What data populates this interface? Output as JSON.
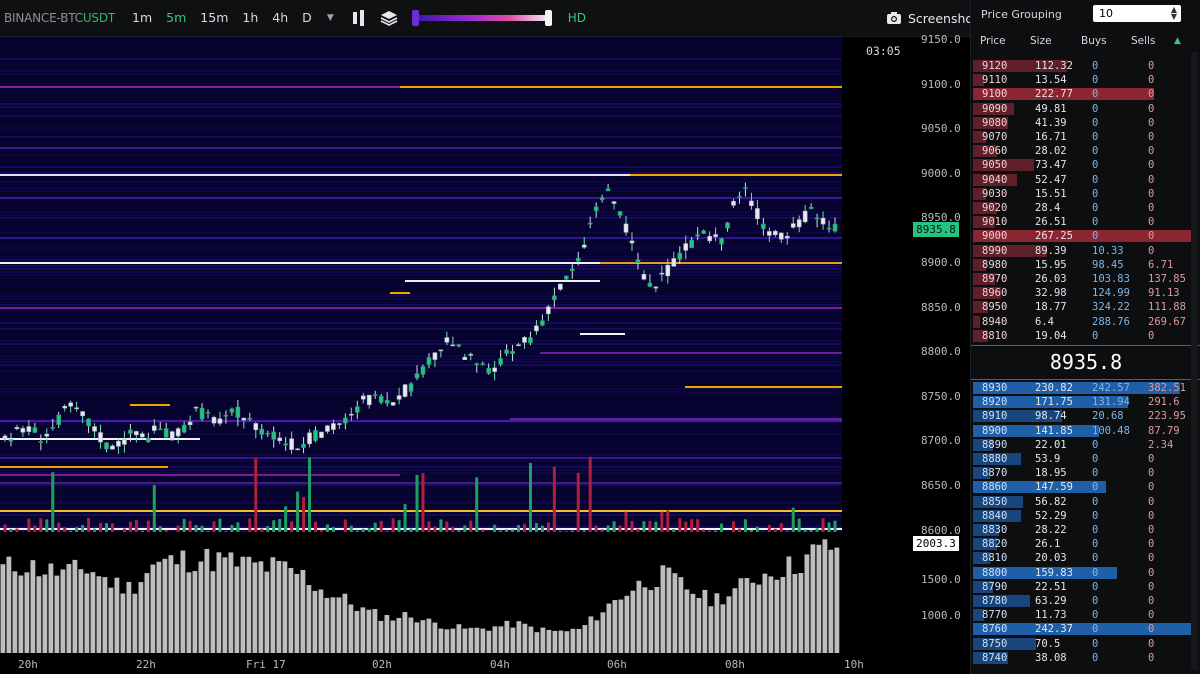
{
  "toolbar": {
    "exchange": "BINANCE-",
    "base": "BTC",
    "quote": "USDT",
    "timeframes": [
      "1m",
      "5m",
      "15m",
      "1h",
      "4h",
      "D"
    ],
    "active_timeframe": "5m",
    "hd_label": "HD",
    "screenshot_label": "Screenshot",
    "icons": [
      "bar-style-icon",
      "layers-icon",
      "camera-icon"
    ]
  },
  "chart": {
    "time_label": "03:05",
    "current_price": "8935.8",
    "volume_value": "2003.3",
    "price_ticks": [
      "9150.0",
      "9100.0",
      "9050.0",
      "9000.0",
      "8950.0",
      "8900.0",
      "8850.0",
      "8800.0",
      "8750.0",
      "8700.0",
      "8650.0",
      "8600.0"
    ],
    "volume_ticks": [
      "1500.0",
      "1000.0"
    ],
    "time_ticks": [
      "20h",
      "22h",
      "Fri 17",
      "02h",
      "04h",
      "06h",
      "08h",
      "10h"
    ],
    "colors": {
      "up": "#26c281",
      "down": "#e84a5f",
      "background": "#050326"
    }
  },
  "orderbook": {
    "grouping_label": "Price Grouping",
    "grouping_value": "10",
    "headers": {
      "price": "Price",
      "size": "Size",
      "buys": "Buys",
      "sells": "Sells"
    },
    "mid_price": "8935.8",
    "asks": [
      {
        "price": "9120",
        "size": "112.32",
        "buys": "0",
        "sells": "0",
        "depth": 0.43
      },
      {
        "price": "9110",
        "size": "13.54",
        "buys": "0",
        "sells": "0",
        "depth": 0.05
      },
      {
        "price": "9100",
        "size": "222.77",
        "buys": "0",
        "sells": "0",
        "depth": 0.83
      },
      {
        "price": "9090",
        "size": "49.81",
        "buys": "0",
        "sells": "0",
        "depth": 0.19
      },
      {
        "price": "9080",
        "size": "41.39",
        "buys": "0",
        "sells": "0",
        "depth": 0.16
      },
      {
        "price": "9070",
        "size": "16.71",
        "buys": "0",
        "sells": "0",
        "depth": 0.06
      },
      {
        "price": "9060",
        "size": "28.02",
        "buys": "0",
        "sells": "0",
        "depth": 0.11
      },
      {
        "price": "9050",
        "size": "73.47",
        "buys": "0",
        "sells": "0",
        "depth": 0.28
      },
      {
        "price": "9040",
        "size": "52.47",
        "buys": "0",
        "sells": "0",
        "depth": 0.2
      },
      {
        "price": "9030",
        "size": "15.51",
        "buys": "0",
        "sells": "0",
        "depth": 0.06
      },
      {
        "price": "9020",
        "size": "28.4",
        "buys": "0",
        "sells": "0",
        "depth": 0.11
      },
      {
        "price": "9010",
        "size": "26.51",
        "buys": "0",
        "sells": "0",
        "depth": 0.1
      },
      {
        "price": "9000",
        "size": "267.25",
        "buys": "0",
        "sells": "0",
        "depth": 1.0
      },
      {
        "price": "8990",
        "size": "89.39",
        "buys": "10.33",
        "sells": "0",
        "depth": 0.34
      },
      {
        "price": "8980",
        "size": "15.95",
        "buys": "98.45",
        "sells": "6.71",
        "depth": 0.06
      },
      {
        "price": "8970",
        "size": "26.03",
        "buys": "103.83",
        "sells": "137.85",
        "depth": 0.1
      },
      {
        "price": "8960",
        "size": "32.98",
        "buys": "124.99",
        "sells": "91.13",
        "depth": 0.13
      },
      {
        "price": "8950",
        "size": "18.77",
        "buys": "324.22",
        "sells": "111.88",
        "depth": 0.07
      },
      {
        "price": "8940",
        "size": "6.4",
        "buys": "288.76",
        "sells": "269.67",
        "depth": 0.03
      },
      {
        "price": "8810",
        "size": "19.04",
        "buys": "0",
        "sells": "0",
        "depth": 0.07
      }
    ],
    "bids": [
      {
        "price": "8930",
        "size": "230.82",
        "buys": "242.57",
        "sells": "382.51",
        "depth": 0.95
      },
      {
        "price": "8920",
        "size": "171.75",
        "buys": "131.94",
        "sells": "291.6",
        "depth": 0.71
      },
      {
        "price": "8910",
        "size": "98.74",
        "buys": "20.68",
        "sells": "223.95",
        "depth": 0.41
      },
      {
        "price": "8900",
        "size": "141.85",
        "buys": "100.48",
        "sells": "87.79",
        "depth": 0.58
      },
      {
        "price": "8890",
        "size": "22.01",
        "buys": "0",
        "sells": "2.34",
        "depth": 0.09
      },
      {
        "price": "8880",
        "size": "53.9",
        "buys": "0",
        "sells": "0",
        "depth": 0.22
      },
      {
        "price": "8870",
        "size": "18.95",
        "buys": "0",
        "sells": "0",
        "depth": 0.08
      },
      {
        "price": "8860",
        "size": "147.59",
        "buys": "0",
        "sells": "0",
        "depth": 0.61
      },
      {
        "price": "8850",
        "size": "56.82",
        "buys": "0",
        "sells": "0",
        "depth": 0.23
      },
      {
        "price": "8840",
        "size": "52.29",
        "buys": "0",
        "sells": "0",
        "depth": 0.22
      },
      {
        "price": "8830",
        "size": "28.22",
        "buys": "0",
        "sells": "0",
        "depth": 0.12
      },
      {
        "price": "8820",
        "size": "26.1",
        "buys": "0",
        "sells": "0",
        "depth": 0.11
      },
      {
        "price": "8810",
        "size": "20.03",
        "buys": "0",
        "sells": "0",
        "depth": 0.08
      },
      {
        "price": "8800",
        "size": "159.83",
        "buys": "0",
        "sells": "0",
        "depth": 0.66
      },
      {
        "price": "8790",
        "size": "22.51",
        "buys": "0",
        "sells": "0",
        "depth": 0.09
      },
      {
        "price": "8780",
        "size": "63.29",
        "buys": "0",
        "sells": "0",
        "depth": 0.26
      },
      {
        "price": "8770",
        "size": "11.73",
        "buys": "0",
        "sells": "0",
        "depth": 0.05
      },
      {
        "price": "8760",
        "size": "242.37",
        "buys": "0",
        "sells": "0",
        "depth": 1.0
      },
      {
        "price": "8750",
        "size": "70.5",
        "buys": "0",
        "sells": "0",
        "depth": 0.29
      },
      {
        "price": "8740",
        "size": "38.08",
        "buys": "0",
        "sells": "0",
        "depth": 0.16
      }
    ]
  }
}
